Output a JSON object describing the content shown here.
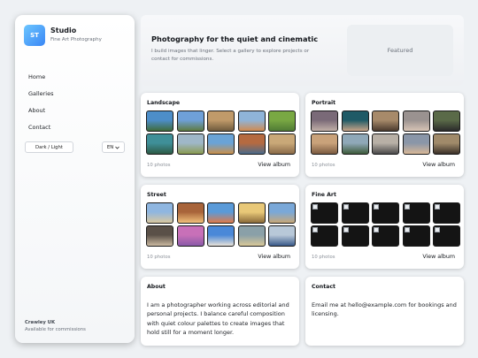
{
  "sidebar": {
    "logo_initials": "ST",
    "brand_name": "Studio",
    "brand_subtitle": "Fine Art Photography",
    "nav": [
      {
        "label": "Home"
      },
      {
        "label": "Galleries"
      },
      {
        "label": "About"
      },
      {
        "label": "Contact"
      }
    ],
    "theme_toggle_label": "Dark / Light",
    "language_selected": "EN",
    "footer_location": "Crawley UK",
    "footer_status": "Available for commissions"
  },
  "hero": {
    "title": "Photography for the quiet and cinematic",
    "description": "I build images that linger. Select a gallery to explore projects or contact for commissions.",
    "featured_label": "Featured"
  },
  "albums": [
    {
      "title": "Landscape",
      "count": "10 photos",
      "view_label": "View album",
      "thumbs": [
        [
          "#4d8ec9",
          "#3f6a3a"
        ],
        [
          "#6fa0d8",
          "#5e7a40"
        ],
        [
          "#c09a6a",
          "#6e5a3c"
        ],
        [
          "#8fb4d8",
          "#d08a50"
        ],
        [
          "#79a843",
          "#4f7a35"
        ],
        [
          "#3f8f98",
          "#2d5a45"
        ],
        [
          "#9fb7c8",
          "#8a9a50"
        ],
        [
          "#6aa3d6",
          "#c98f4a"
        ],
        [
          "#b56a40",
          "#4a6a8a"
        ],
        [
          "#c9a878",
          "#8a6a48"
        ]
      ]
    },
    {
      "title": "Portrait",
      "count": "10 photos",
      "view_label": "View album",
      "thumbs": [
        [
          "#7a6a78",
          "#c2b0a8"
        ],
        [
          "#1f5a66",
          "#c7a488"
        ],
        [
          "#a78a6a",
          "#4a3a2e"
        ],
        [
          "#9a9290",
          "#d8c4b6"
        ],
        [
          "#5a6a48",
          "#2a2a2a"
        ],
        [
          "#c9a27a",
          "#7a5a40"
        ],
        [
          "#8fa8b8",
          "#3d5a3a"
        ],
        [
          "#b8b0a6",
          "#4a4a4a"
        ],
        [
          "#8a96a8",
          "#d8b898"
        ],
        [
          "#a08a6a",
          "#3a3028"
        ]
      ]
    },
    {
      "title": "Street",
      "count": "10 photos",
      "view_label": "View album",
      "thumbs": [
        [
          "#8fb6e0",
          "#d8c7a0"
        ],
        [
          "#a8643a",
          "#f0c07a"
        ],
        [
          "#5a9ad8",
          "#e07a4a"
        ],
        [
          "#e8c878",
          "#8a6a3a"
        ],
        [
          "#7aa8d8",
          "#c8a878"
        ],
        [
          "#5a5048",
          "#c9b8a0"
        ],
        [
          "#c870b8",
          "#8a5aa8"
        ],
        [
          "#4a88d8",
          "#e8e2d8"
        ],
        [
          "#8aa0a8",
          "#d8c898"
        ],
        [
          "#b8c8d8",
          "#3a5a8a"
        ]
      ]
    },
    {
      "title": "Fine Art",
      "count": "10 photos",
      "view_label": "View album",
      "thumbs": []
    }
  ],
  "about": {
    "title": "About",
    "text": "I am a photographer working across editorial and personal projects. I balance careful composition with quiet colour palettes to create images that hold still for a moment longer."
  },
  "contact": {
    "title": "Contact",
    "text": "Email me at hello@example.com for bookings and licensing."
  }
}
